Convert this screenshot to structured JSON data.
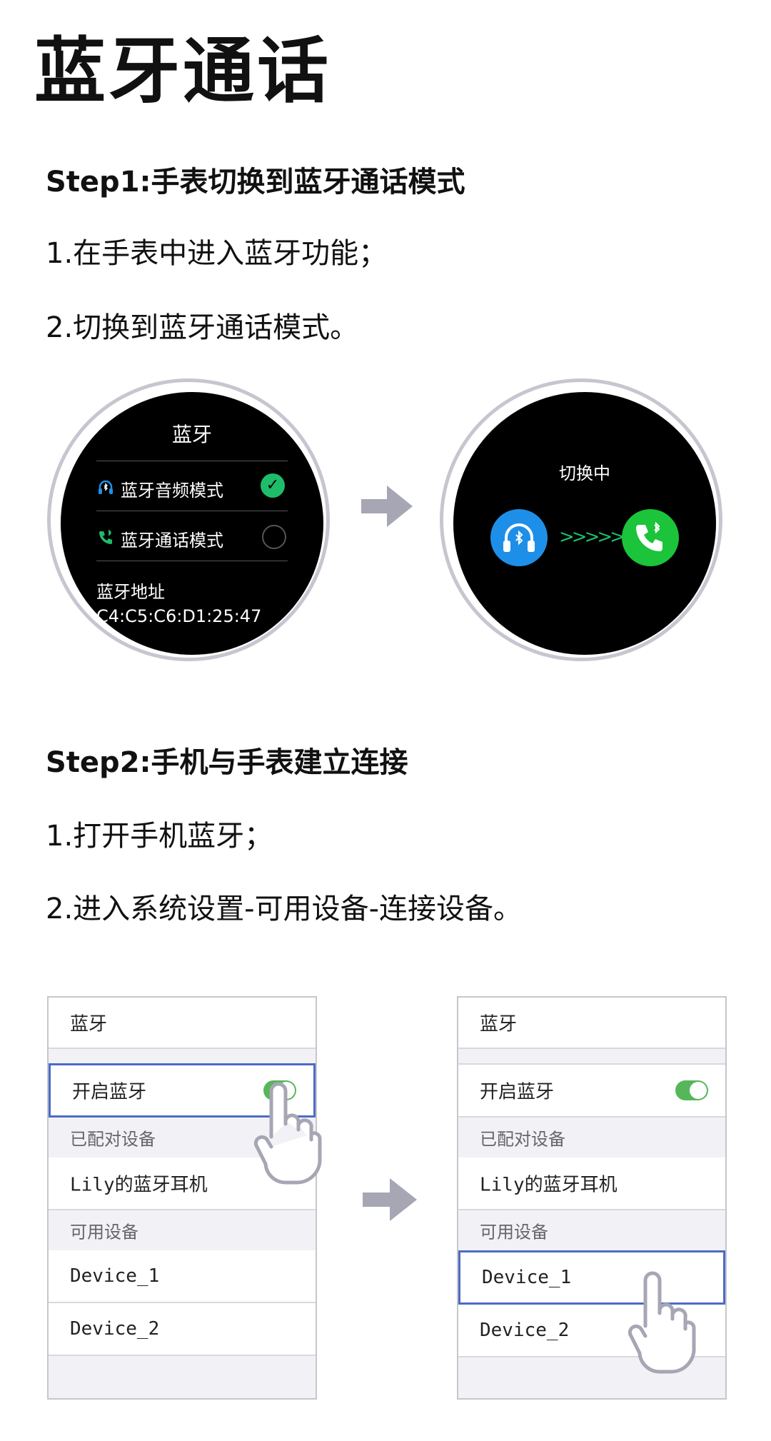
{
  "title": "蓝牙通话",
  "step1": {
    "heading": "Step1:手表切换到蓝牙通话模式",
    "lines": [
      "1.在手表中进入蓝牙功能；",
      "2.切换到蓝牙通话模式。"
    ]
  },
  "watch1": {
    "title": "蓝牙",
    "rows": [
      {
        "label": "蓝牙音频模式",
        "icon": "headphone-bluetooth-icon",
        "checked": true
      },
      {
        "label": "蓝牙通话模式",
        "icon": "phone-bluetooth-icon",
        "checked": false
      }
    ],
    "addr_label": "蓝牙地址",
    "addr_value": "C4:C5:C6:D1:25:47"
  },
  "watch2": {
    "title": "切换中",
    "from_icon": "headphone-bluetooth-icon",
    "to_icon": "phone-bluetooth-icon",
    "arrows": ">>>>>"
  },
  "step2": {
    "heading": "Step2:手机与手表建立连接",
    "lines": [
      "1.打开手机蓝牙；",
      "2.进入系统设置-可用设备-连接设备。"
    ]
  },
  "phone": {
    "header": "蓝牙",
    "toggle_label": "开启蓝牙",
    "paired_section": "已配对设备",
    "paired_device": "Lily的蓝牙耳机",
    "available_section": "可用设备",
    "devices": [
      "Device_1",
      "Device_2"
    ]
  },
  "colors": {
    "accent_green": "#1fbd6a",
    "toggle_green": "#56b65a",
    "highlight_blue": "#4d6bc6",
    "headphone_blue": "#1e8fe8"
  }
}
